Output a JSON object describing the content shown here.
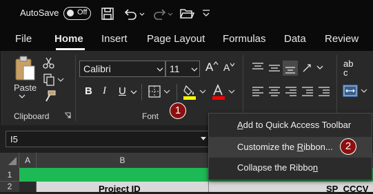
{
  "titlebar": {
    "autosave_label": "AutoSave",
    "autosave_state": "Off"
  },
  "tabs": [
    "File",
    "Home",
    "Insert",
    "Page Layout",
    "Formulas",
    "Data",
    "Review"
  ],
  "ribbon": {
    "paste_label": "Paste",
    "clipboard_group": "Clipboard",
    "font_group": "Font",
    "font_name": "Calibri",
    "font_size": "11",
    "bold": "B",
    "italic": "I",
    "underline": "U",
    "grow_font": "A",
    "shrink_font": "A",
    "wrap_abc": "ab",
    "wrap_c": "c"
  },
  "formula_bar": {
    "name_box": "I5"
  },
  "grid": {
    "columns": [
      "A",
      "B"
    ],
    "rows": [
      "1",
      "2"
    ],
    "cells": {
      "b2": "Project ID",
      "c2": "SP_CCCV_i"
    }
  },
  "context_menu": {
    "items": [
      {
        "prefix": "",
        "accel": "A",
        "rest": "dd to Quick Access Toolbar"
      },
      {
        "prefix": "Customize the ",
        "accel": "R",
        "rest": "ibbon..."
      },
      {
        "prefix": "Collapse the Ribbo",
        "accel": "n",
        "rest": ""
      }
    ]
  },
  "annotations": {
    "badge1": "1",
    "badge2": "2"
  },
  "colors": {
    "green_row": "#1db954",
    "highlight_yellow": "#ffff00",
    "font_red": "#ff0000",
    "badge": "#8c0f0f"
  }
}
